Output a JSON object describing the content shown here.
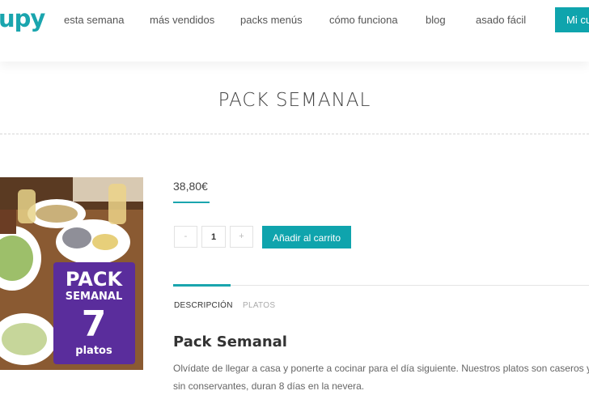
{
  "header": {
    "logo": "upy",
    "nav": [
      "esta semana",
      "más vendidos",
      "packs menús",
      "cómo funciona",
      "blog",
      "asado fácil"
    ],
    "cta_label": "Mi cu"
  },
  "page": {
    "title": "PACK SEMANAL"
  },
  "product": {
    "image_badge": {
      "line1": "PACK",
      "line2": "SEMANAL",
      "number": "7",
      "line3": "platos"
    },
    "price": "38,80€",
    "quantity": "1",
    "minus_label": "-",
    "plus_label": "+",
    "add_to_cart_label": "Añadir al carrito",
    "tabs": [
      {
        "label": "DESCRIPCIÓN",
        "active": true
      },
      {
        "label": "PLATOS",
        "active": false
      }
    ],
    "description_heading": "Pack Semanal",
    "description_text": "Olvídate de llegar a casa y ponerte a cocinar para el día siguiente. Nuestros platos son caseros y sin conservantes, duran 8 días en la nevera."
  },
  "colors": {
    "accent": "#0fa4ad",
    "badge": "#5a2d9c"
  }
}
